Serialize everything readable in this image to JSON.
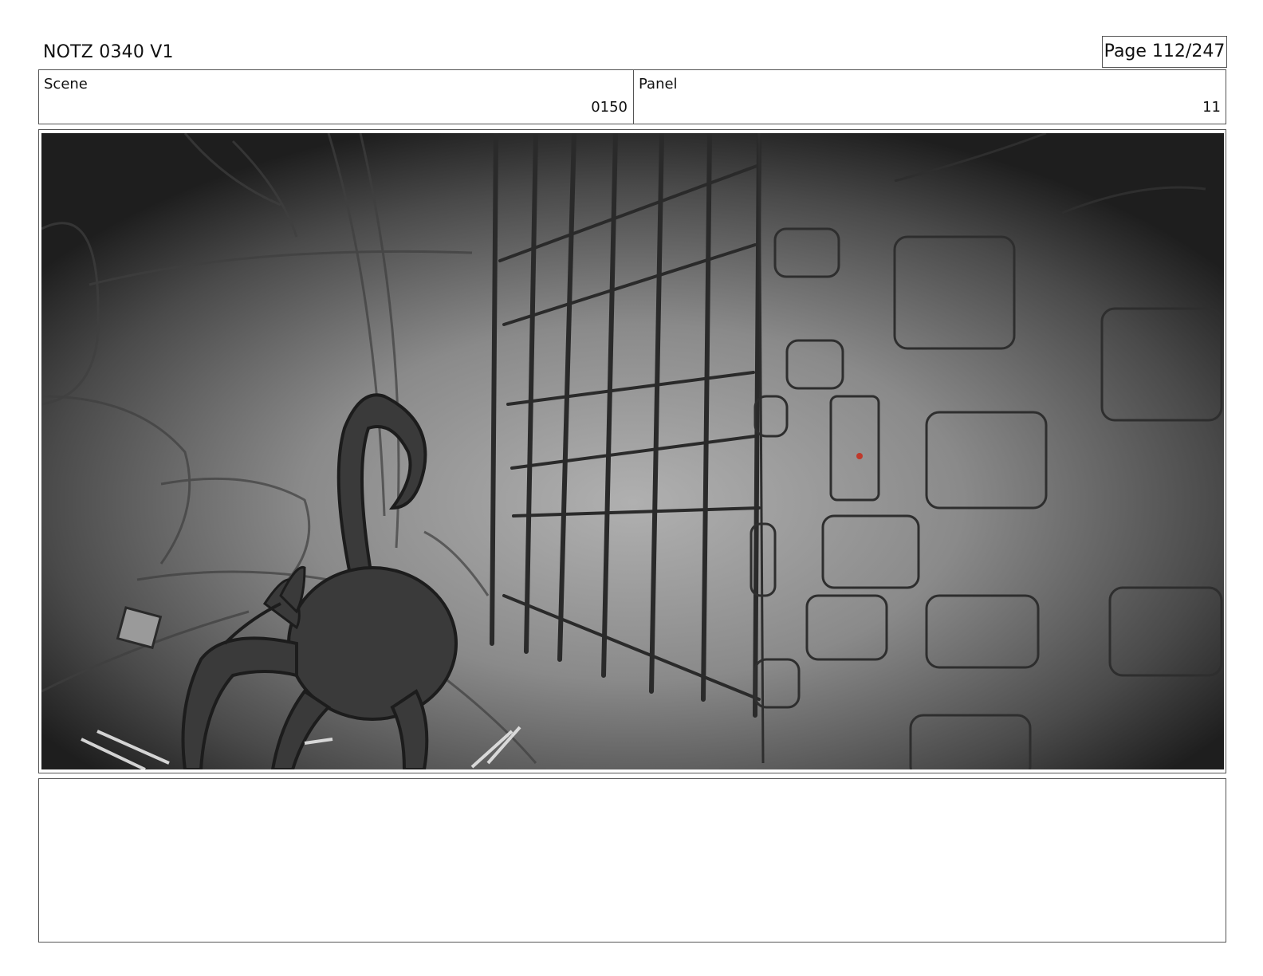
{
  "header": {
    "title": "NOTZ 0340 V1",
    "page": "Page 112/247"
  },
  "info": {
    "scene_label": "Scene",
    "scene_value": "0150",
    "panel_label": "Panel",
    "panel_value": "11"
  },
  "frame": {
    "description_icon": "storyboard-sketch",
    "palette": {
      "dark": "#1f1f1f",
      "mid": "#6b6b6b",
      "light": "#a8a8a8",
      "line": "#2a2a2a",
      "accent": "#c0392b"
    }
  },
  "notes": {
    "text": ""
  }
}
